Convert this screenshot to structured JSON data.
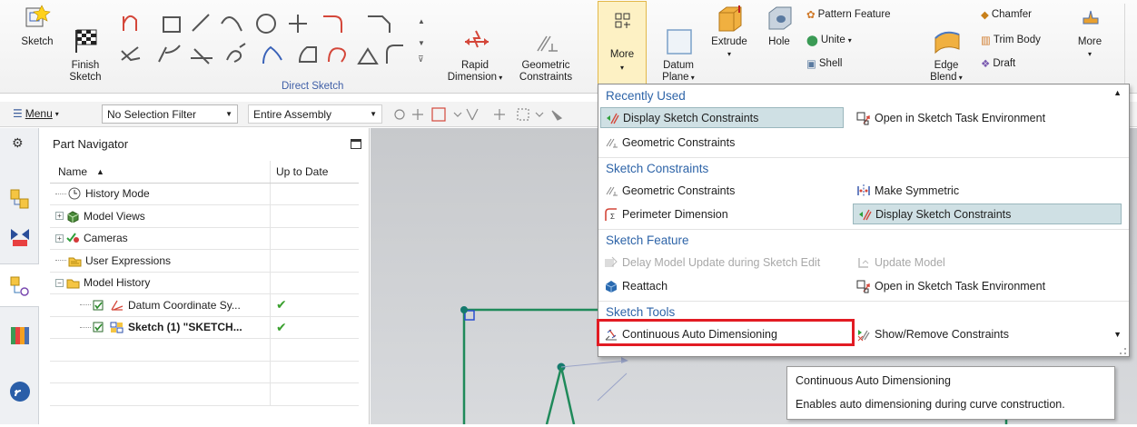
{
  "ribbon": {
    "sketch_label": "Sketch",
    "finish_sketch_label": "Finish\nSketch",
    "direct_sketch_group": "Direct Sketch",
    "rapid_dimension_label": "Rapid\nDimension",
    "geometric_constraints_label": "Geometric\nConstraints",
    "more_label": "More",
    "datum_plane_label": "Datum\nPlane",
    "extrude_label": "Extrude",
    "hole_label": "Hole",
    "pattern_feature_label": "Pattern Feature",
    "unite_label": "Unite",
    "shell_label": "Shell",
    "edge_blend_label": "Edge\nBlend",
    "chamfer_label": "Chamfer",
    "trim_body_label": "Trim Body",
    "draft_label": "Draft",
    "more2_label": "More"
  },
  "toolbar": {
    "menu_label": "Menu",
    "selection_filter": "No Selection Filter",
    "assembly_scope": "Entire Assembly"
  },
  "navigator": {
    "title": "Part Navigator",
    "col_name": "Name",
    "col_uptodate": "Up to Date",
    "rows": [
      {
        "label": "History Mode",
        "indent": 1,
        "expander": "",
        "up": ""
      },
      {
        "label": "Model Views",
        "indent": 1,
        "expander": "+",
        "up": ""
      },
      {
        "label": "Cameras",
        "indent": 1,
        "expander": "+",
        "up": ""
      },
      {
        "label": "User Expressions",
        "indent": 1,
        "expander": "",
        "up": ""
      },
      {
        "label": "Model History",
        "indent": 1,
        "expander": "−",
        "up": ""
      },
      {
        "label": "Datum Coordinate Sy...",
        "indent": 2,
        "expander": "",
        "up": "✔"
      },
      {
        "label": "Sketch (1) \"SKETCH...",
        "indent": 2,
        "expander": "",
        "up": "✔"
      }
    ]
  },
  "menu": {
    "sections": {
      "recently_used": "Recently Used",
      "sketch_constraints": "Sketch Constraints",
      "sketch_feature": "Sketch Feature",
      "sketch_tools": "Sketch Tools"
    },
    "items": {
      "display_sketch_constraints": "Display Sketch Constraints",
      "open_in_sketch_task_env": "Open in Sketch Task Environment",
      "geometric_constraints": "Geometric Constraints",
      "make_symmetric": "Make Symmetric",
      "perimeter_dimension": "Perimeter Dimension",
      "delay_model_update": "Delay Model Update during Sketch Edit",
      "update_model": "Update Model",
      "reattach": "Reattach",
      "continuous_auto_dimensioning": "Continuous Auto Dimensioning",
      "show_remove_constraints": "Show/Remove Constraints"
    }
  },
  "tooltip": {
    "title": "Continuous Auto Dimensioning",
    "description": "Enables auto dimensioning during curve construction."
  }
}
